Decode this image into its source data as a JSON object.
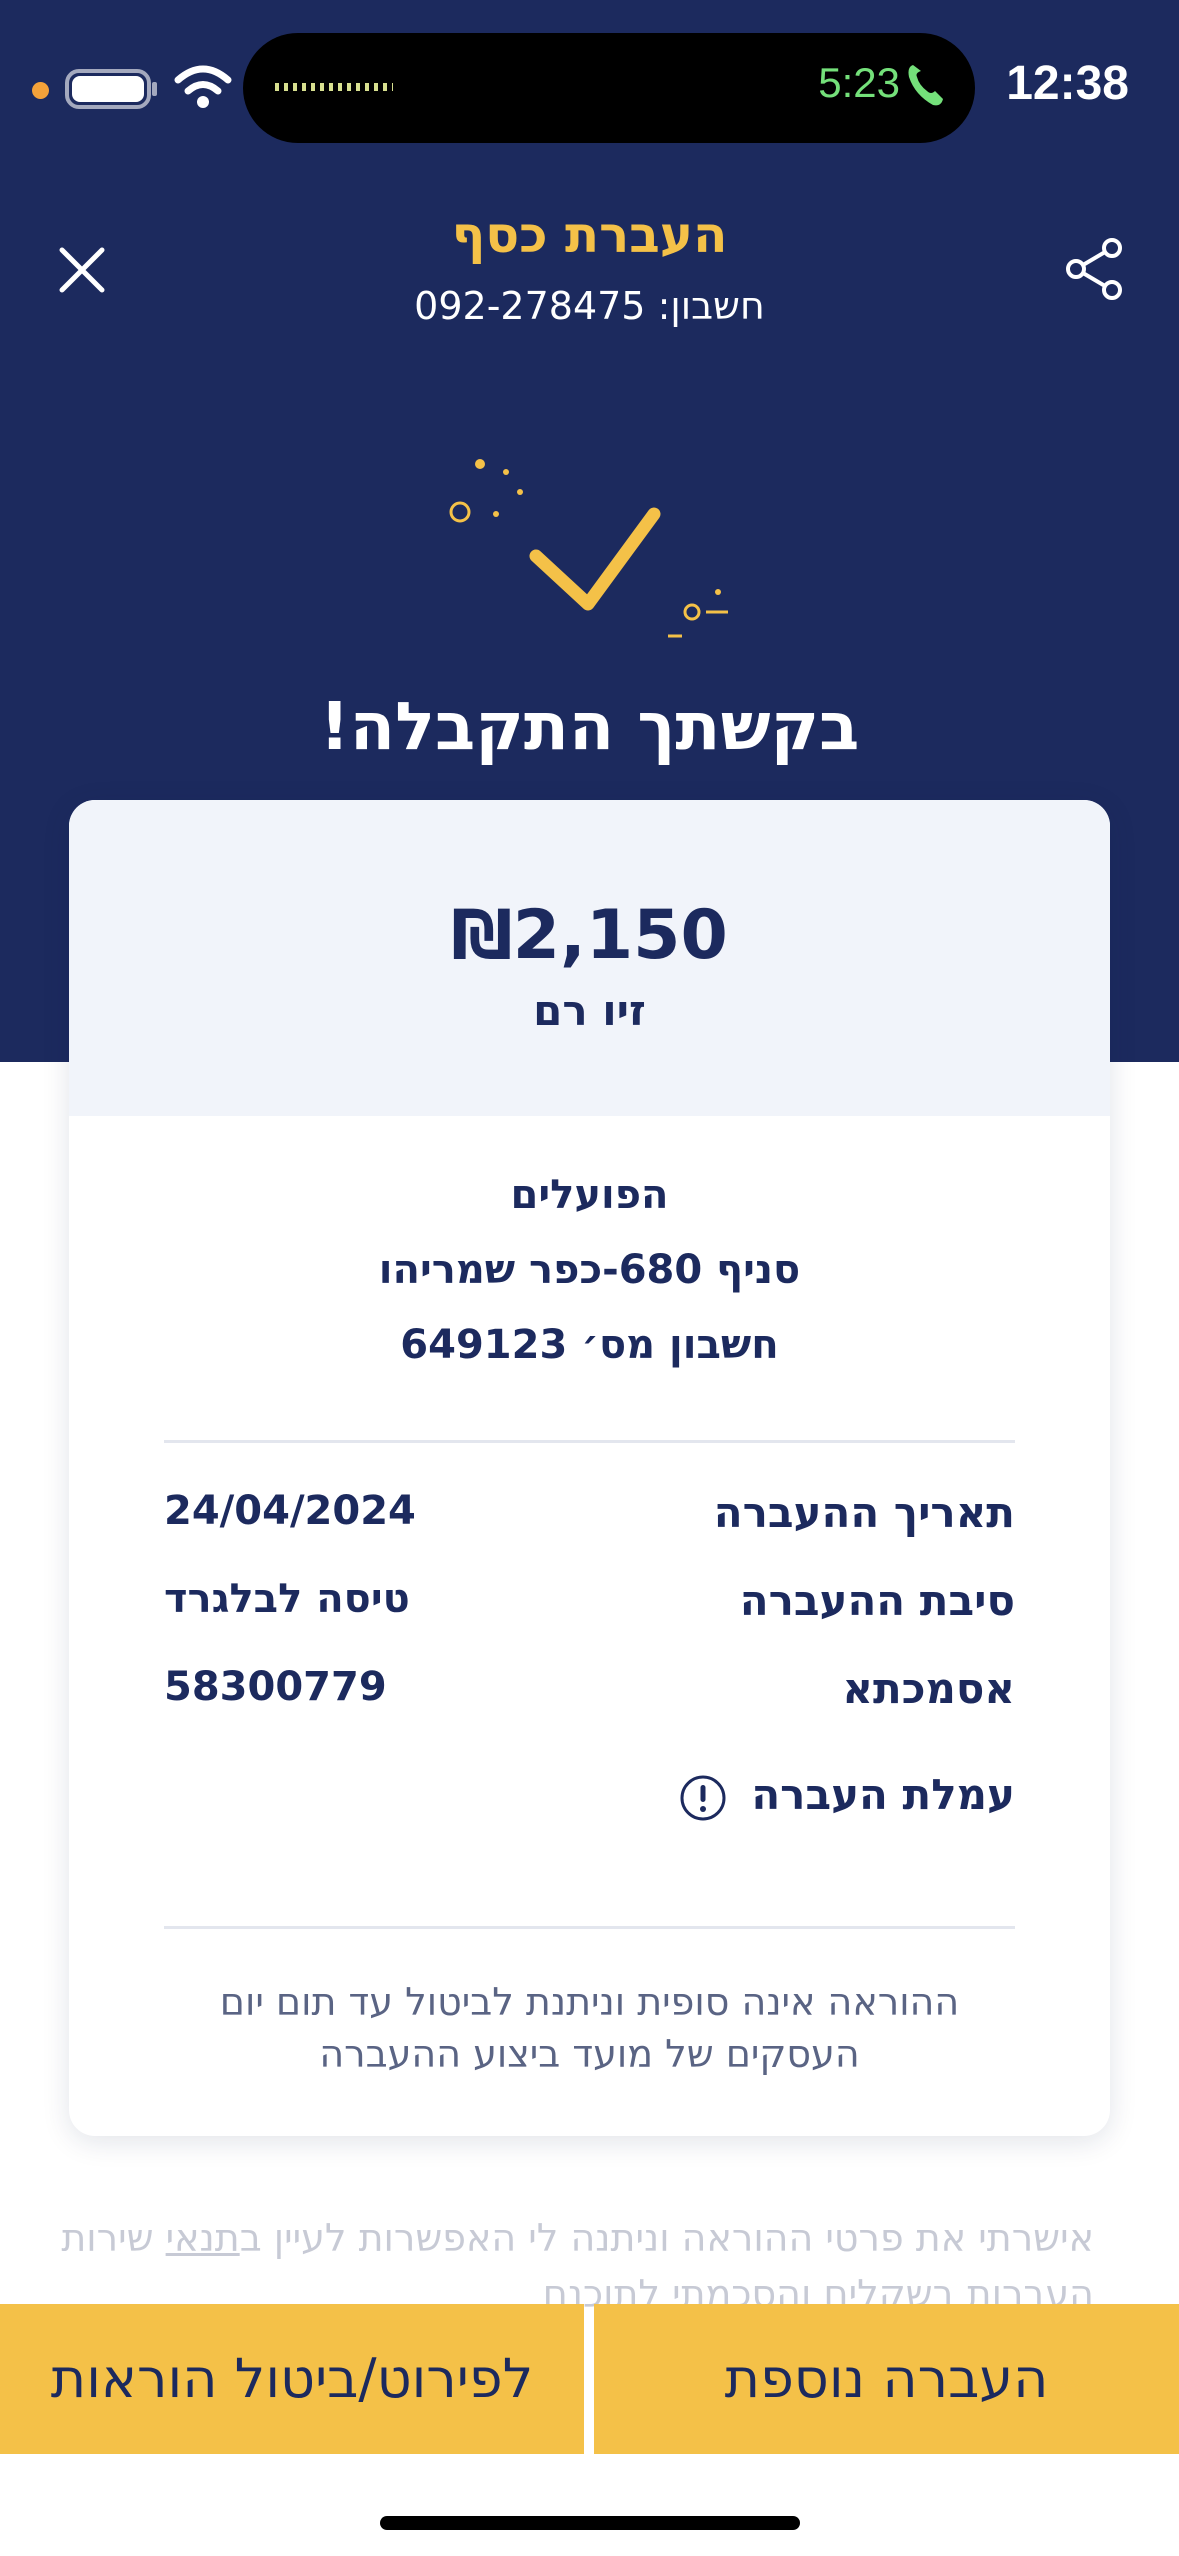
{
  "status_bar": {
    "time": "12:38",
    "call_time": "5:23"
  },
  "header": {
    "title": "העברת כסף",
    "account_label": "חשבון:",
    "account_number": "092-278475"
  },
  "success": {
    "message": "בקשתך התקבלה!"
  },
  "card": {
    "amount": "₪2,150",
    "recipient": "זיו רם",
    "bank_name": "הפועלים",
    "branch": "סניף 680-כפר שמריהו",
    "account": "חשבון מס׳ 649123",
    "details": [
      {
        "label": "תאריך ההעברה",
        "value": "24/04/2024"
      },
      {
        "label": "סיבת ההעברה",
        "value": "טיסה לבלגרד"
      },
      {
        "label": "אסמכתא",
        "value": "58300779"
      }
    ],
    "fee_label": "עמלת העברה",
    "notice": "ההוראה אינה סופית וניתנת לביטול עד תום יום העסקים של מועד ביצוע ההעברה"
  },
  "consent": {
    "text_before": "אישרתי את פרטי ההוראה וניתנה לי האפשרות לעיין ב",
    "link_text": "תנאי",
    "text_after": " שירות העברות בשקלים והסכמתי לתוכנם"
  },
  "actions": {
    "another_transfer": "העברה נוספת",
    "details_cancel": "לפירוט/ביטול הוראות"
  },
  "colors": {
    "navy": "#1c2a5e",
    "yellow": "#f4c148",
    "light_card": "#f1f4fa"
  }
}
